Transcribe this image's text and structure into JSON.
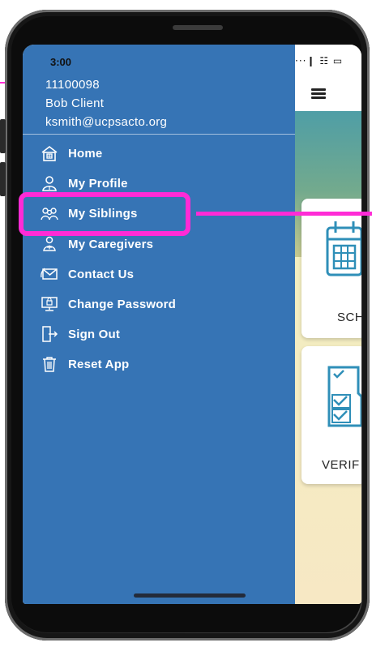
{
  "status_bar": {
    "time": "3:00",
    "icons": "···❙ ☷ ▭"
  },
  "user": {
    "id": "11100098",
    "name": "Bob  Client",
    "email": "ksmith@ucpsacto.org"
  },
  "menu": {
    "items": [
      {
        "label": "Home",
        "icon": "home-icon"
      },
      {
        "label": "My Profile",
        "icon": "profile-icon"
      },
      {
        "label": "My Siblings",
        "icon": "siblings-icon"
      },
      {
        "label": "My Caregivers",
        "icon": "caregivers-icon"
      },
      {
        "label": "Contact Us",
        "icon": "mail-icon"
      },
      {
        "label": "Change Password",
        "icon": "computer-icon"
      },
      {
        "label": "Sign Out",
        "icon": "sign-out-icon"
      },
      {
        "label": "Reset App",
        "icon": "trash-icon"
      }
    ]
  },
  "app": {
    "cards": [
      {
        "label": "SCH",
        "icon": "calendar-icon"
      },
      {
        "label": "VERIF",
        "icon": "checklist-icon"
      }
    ]
  },
  "colors": {
    "drawer_bg": "#3674b5",
    "highlight": "#ff2bd6",
    "icon_teal": "#2f8fb8"
  }
}
